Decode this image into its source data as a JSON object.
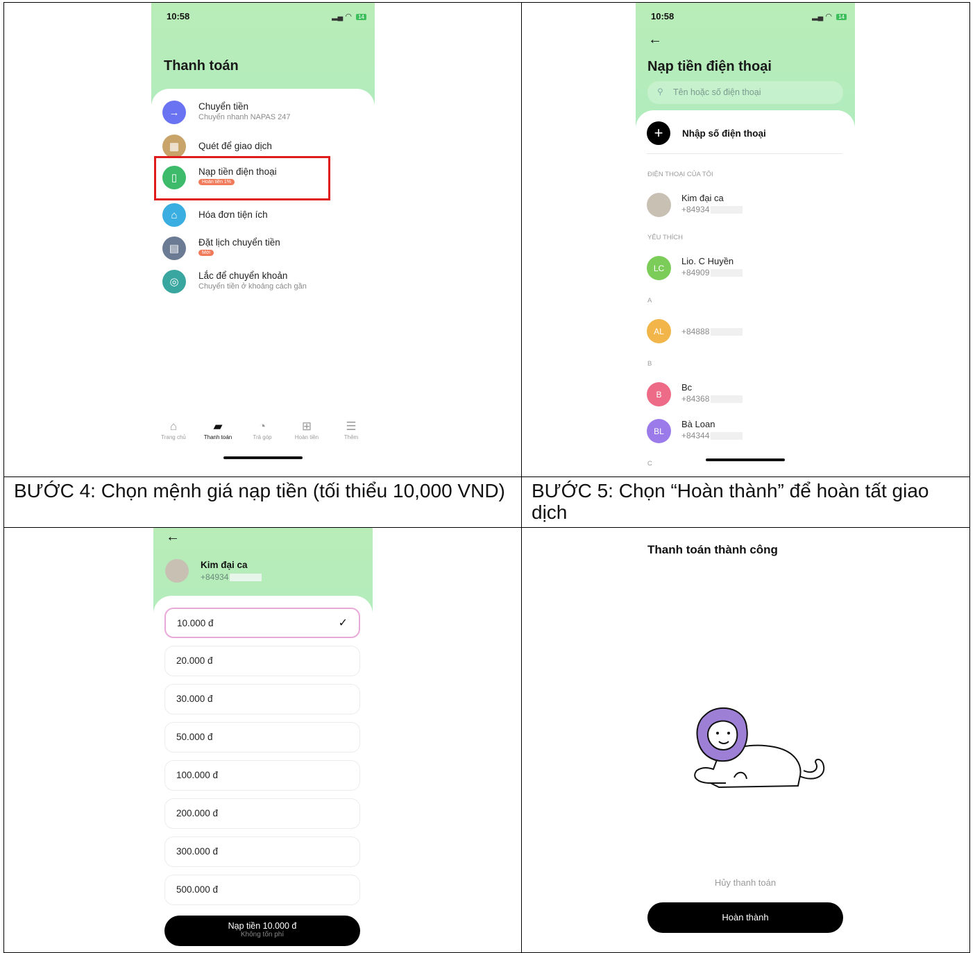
{
  "screen1": {
    "time": "10:58",
    "battery": "14",
    "title": "Thanh toán",
    "items": [
      {
        "icon": "arrow-right-icon",
        "color": "#6a74f2",
        "title": "Chuyển tiền",
        "subtitle": "Chuyển nhanh NAPAS 247"
      },
      {
        "icon": "qr-scan-icon",
        "color": "#c9a46a",
        "title": "Quét để giao dịch"
      },
      {
        "icon": "phone-icon",
        "color": "#3dbb6a",
        "title": "Nạp tiền điện thoại",
        "badge": "Hoàn tiền 1%"
      },
      {
        "icon": "house-icon",
        "color": "#3aaee0",
        "title": "Hóa đơn tiện ích"
      },
      {
        "icon": "calendar-icon",
        "color": "#6b7b93",
        "title": "Đặt lịch chuyển tiền",
        "badge": "Mới"
      },
      {
        "icon": "nfc-icon",
        "color": "#3aa6a0",
        "title": "Lắc để chuyển khoản",
        "subtitle": "Chuyển tiền ở khoảng cách gần"
      }
    ],
    "tabs": [
      {
        "icon": "home-icon",
        "label": "Trang chủ"
      },
      {
        "icon": "wallet-icon",
        "label": "Thanh toán"
      },
      {
        "icon": "pie-chart-icon",
        "label": "Trả góp"
      },
      {
        "icon": "gift-icon",
        "label": "Hoàn tiền"
      },
      {
        "icon": "menu-icon",
        "label": "Thêm"
      }
    ],
    "highlight_color": "#e01b1b"
  },
  "screen2": {
    "time": "10:58",
    "battery": "14",
    "title": "Nạp tiền điện thoại",
    "search_placeholder": "Tên hoặc số điện thoại",
    "add_label": "Nhập số điện thoại",
    "sections": {
      "mine": "ĐIỆN THOẠI CỦA TÔI",
      "fav": "YÊU THÍCH",
      "a": "A",
      "b": "B",
      "c": "C"
    },
    "contacts": [
      {
        "initials": "",
        "color": "#c9c0b4",
        "name": "Kim đại ca",
        "phone": "+84934"
      },
      {
        "initials": "LC",
        "color": "#7ccc5a",
        "name": "Lio. C Huyền",
        "phone": "+84909"
      },
      {
        "initials": "AL",
        "color": "#f2b54a",
        "name": "",
        "phone": "+84888"
      },
      {
        "initials": "B",
        "color": "#ee6b87",
        "name": "Bc",
        "phone": "+84368"
      },
      {
        "initials": "BL",
        "color": "#9b7bea",
        "name": "Bà Loan",
        "phone": "+84344"
      }
    ]
  },
  "caption_left": "BƯỚC 4: Chọn mệnh giá nạp tiền (tối thiểu 10,000 VND)",
  "caption_right": "BƯỚC 5: Chọn “Hoàn thành” để hoàn tất giao dịch",
  "screen3": {
    "name": "Kim đại ca",
    "phone": "+84934",
    "amounts": [
      "10.000 đ",
      "20.000 đ",
      "30.000 đ",
      "50.000 đ",
      "100.000 đ",
      "200.000 đ",
      "300.000 đ",
      "500.000 đ"
    ],
    "selected_amount": "10.000 đ",
    "cta": "Nạp tiền 10.000 đ",
    "cta_sub": "Không tốn phí"
  },
  "screen4": {
    "title": "Thanh toán thành công",
    "cancel": "Hủy thanh toán",
    "done": "Hoàn thành"
  }
}
